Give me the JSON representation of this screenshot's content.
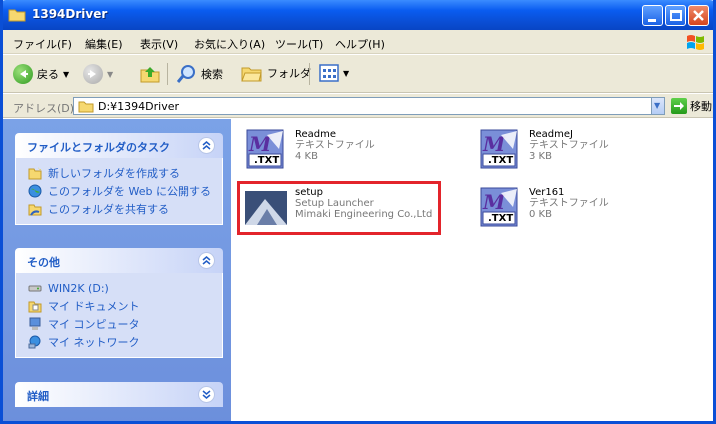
{
  "window": {
    "title": "1394Driver"
  },
  "menu": [
    "ファイル(F)",
    "編集(E)",
    "表示(V)",
    "お気に入り(A)",
    "ツール(T)",
    "ヘルプ(H)"
  ],
  "toolbar": {
    "back": "戻る",
    "search": "検索",
    "folders": "フォルダ"
  },
  "address": {
    "label": "アドレス(D)",
    "value": "D:¥1394Driver",
    "go": "移動"
  },
  "tasks_panel": {
    "title": "ファイルとフォルダのタスク",
    "items": [
      "新しいフォルダを作成する",
      "このフォルダを Web に公開する",
      "このフォルダを共有する"
    ]
  },
  "other_panel": {
    "title": "その他",
    "items": [
      "WIN2K (D:)",
      "マイ ドキュメント",
      "マイ コンピュータ",
      "マイ ネットワーク"
    ]
  },
  "details_panel": {
    "title": "詳細"
  },
  "files": [
    {
      "name": "Readme",
      "line2": "テキストファイル",
      "line3": "4 KB",
      "icon": "txt-file-icon"
    },
    {
      "name": "ReadmeJ",
      "line2": "テキストファイル",
      "line3": "3 KB",
      "icon": "txt-file-icon"
    },
    {
      "name": "setup",
      "line2": "Setup Launcher",
      "line3": "Mimaki Engineering Co.,Ltd",
      "icon": "setup-app-icon"
    },
    {
      "name": "Ver161",
      "line2": "テキストファイル",
      "line3": "0 KB",
      "icon": "txt-file-icon"
    }
  ],
  "icon_label": ".TXT",
  "colors": {
    "titlebar": "#0a4fd6",
    "left_pane": "#7ba2e7",
    "highlight": "#e3242b"
  }
}
